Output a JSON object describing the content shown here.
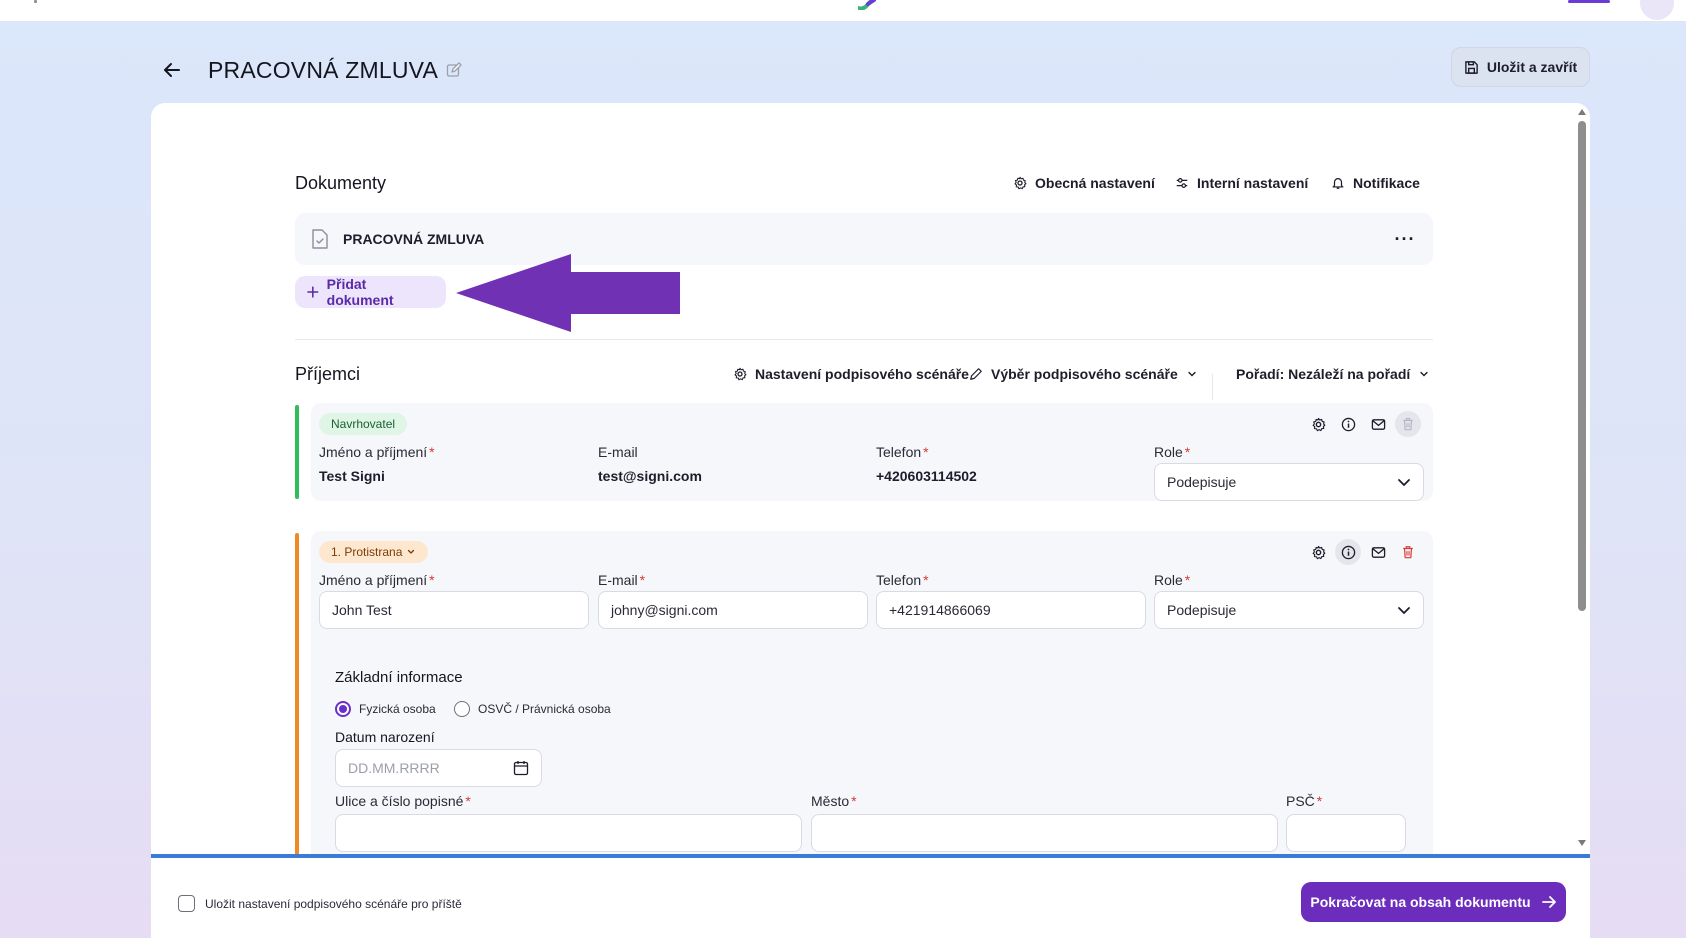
{
  "header": {
    "title": "PRACOVNÁ ZMLUVA",
    "save_close_label": "Uložit a zavřít"
  },
  "documents": {
    "section_title": "Dokumenty",
    "toolbar": {
      "general_settings": "Obecná nastavení",
      "internal_settings": "Interní nastavení",
      "notifications": "Notifikace"
    },
    "items": [
      {
        "name": "PRACOVNÁ ZMLUVA",
        "more_label": "···"
      }
    ],
    "add_label": "Přidat dokument"
  },
  "recipients": {
    "section_title": "Příjemci",
    "toolbar": {
      "scenario_settings": "Nastavení podpisového scénáře",
      "scenario_select": "Výběr podpisového scénáře",
      "order": "Pořadí: Nezáleží na pořadí"
    },
    "labels": {
      "name": "Jméno a příjmení",
      "email": "E-mail",
      "phone": "Telefon",
      "role": "Role",
      "required_mark": "*"
    },
    "proposer": {
      "badge": "Navrhovatel",
      "name": "Test Signi",
      "email": "test@signi.com",
      "phone": "+420603114502",
      "role": "Podepisuje",
      "accent_color": "#2ebd59"
    },
    "counterparty": {
      "badge": "1. Protistrana",
      "name": "John Test",
      "email": "johny@signi.com",
      "phone": "+421914866069",
      "role": "Podepisuje",
      "accent_color": "#f08a24",
      "basic_info": {
        "title": "Základní informace",
        "person_types": [
          "Fyzická osoba",
          "OSVČ / Právnická osoba"
        ],
        "selected_person_type": "Fyzická osoba",
        "birth_date_label": "Datum narození",
        "birth_date_placeholder": "DD.MM.RRRR",
        "street_label": "Ulice a číslo popisné",
        "city_label": "Město",
        "zip_label": "PSČ"
      }
    }
  },
  "footer": {
    "save_scenario_label": "Uložit nastavení podpisového scénáře pro příště",
    "continue_label": "Pokračovat na obsah dokumentu"
  },
  "colors": {
    "primary": "#6c2dbd",
    "annotation_arrow": "#7031b5",
    "required": "#d23b3b",
    "delete": "#e03a3a"
  }
}
